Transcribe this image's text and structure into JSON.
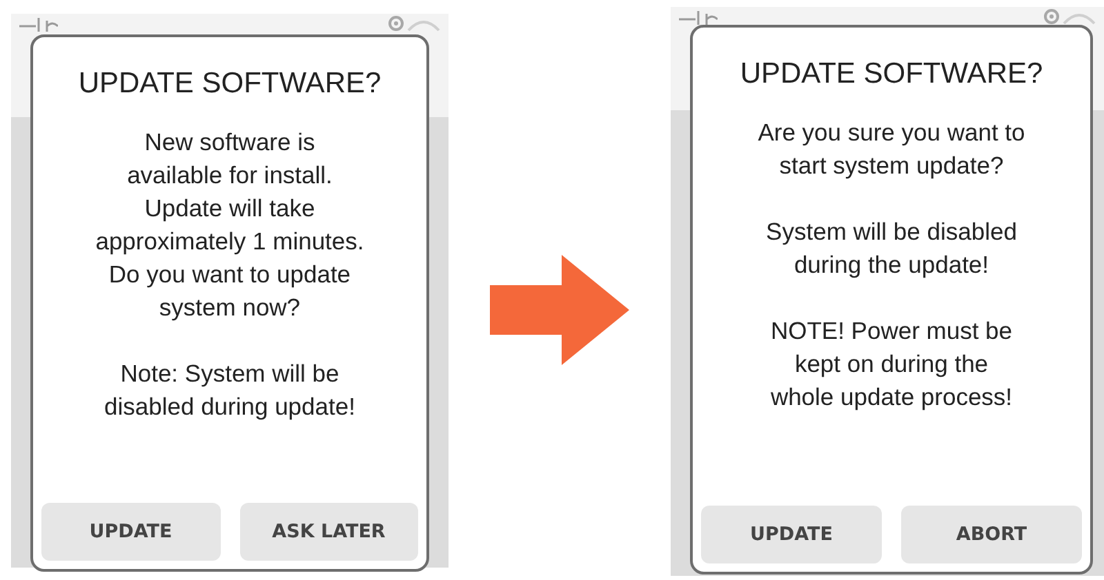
{
  "screens": [
    {
      "dialog": {
        "title": "UPDATE SOFTWARE?",
        "paragraphs": [
          {
            "lines": [
              "New software is",
              "available for install.",
              "Update will take",
              "approximately 1 minutes.",
              "Do you want to update",
              "system now?"
            ]
          },
          {
            "lines": [
              "Note: System will be",
              "disabled during update!"
            ]
          }
        ],
        "buttons": [
          "UPDATE",
          "ASK LATER"
        ]
      }
    },
    {
      "dialog": {
        "title": "UPDATE SOFTWARE?",
        "paragraphs": [
          {
            "lines": [
              "Are you sure you want to",
              "start system update?"
            ]
          },
          {
            "lines": [
              "System will be disabled",
              "during the update!"
            ]
          },
          {
            "lines": [
              "NOTE! Power must be",
              "kept on during the",
              "whole update process!"
            ]
          }
        ],
        "buttons": [
          "UPDATE",
          "ABORT"
        ]
      }
    }
  ]
}
